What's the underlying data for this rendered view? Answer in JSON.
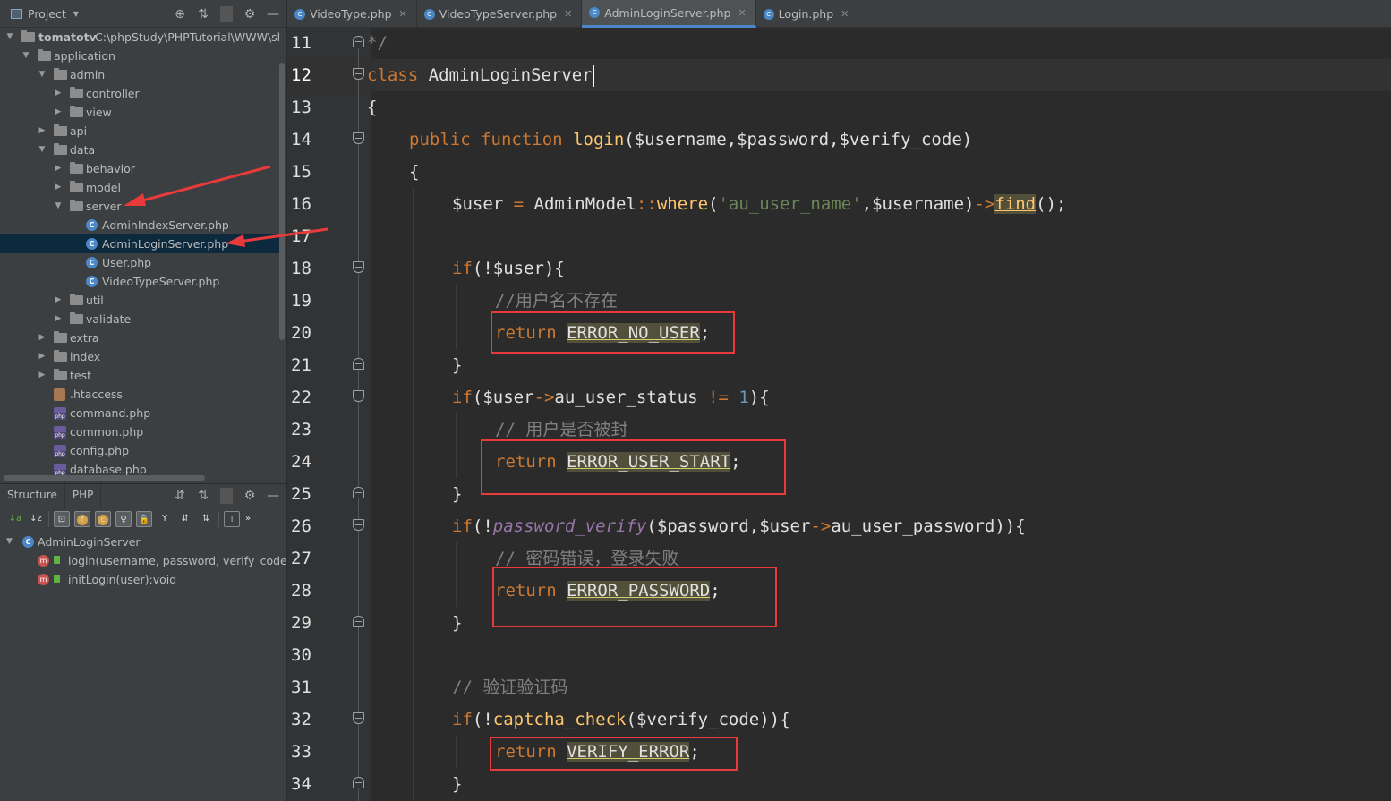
{
  "project": {
    "title": "Project",
    "root_name": "tomatotv",
    "root_path": "C:\\phpStudy\\PHPTutorial\\WWW\\ship",
    "tree": [
      {
        "label": "application",
        "arrow": "▼",
        "type": "folder"
      },
      {
        "label": "admin",
        "arrow": "▼",
        "type": "folder"
      },
      {
        "label": "controller",
        "arrow": "▶",
        "type": "folder"
      },
      {
        "label": "view",
        "arrow": "▶",
        "type": "folder"
      },
      {
        "label": "api",
        "arrow": "▶",
        "type": "folder"
      },
      {
        "label": "data",
        "arrow": "▼",
        "type": "folder"
      },
      {
        "label": "behavior",
        "arrow": "▶",
        "type": "folder"
      },
      {
        "label": "model",
        "arrow": "▶",
        "type": "folder"
      },
      {
        "label": "server",
        "arrow": "▼",
        "type": "folder"
      },
      {
        "label": "AdminIndexServer.php",
        "arrow": "",
        "type": "class"
      },
      {
        "label": "AdminLoginServer.php",
        "arrow": "",
        "type": "class"
      },
      {
        "label": "User.php",
        "arrow": "",
        "type": "class"
      },
      {
        "label": "VideoTypeServer.php",
        "arrow": "",
        "type": "class"
      },
      {
        "label": "util",
        "arrow": "▶",
        "type": "folder"
      },
      {
        "label": "validate",
        "arrow": "▶",
        "type": "folder"
      },
      {
        "label": "extra",
        "arrow": "▶",
        "type": "folder"
      },
      {
        "label": "index",
        "arrow": "▶",
        "type": "folder"
      },
      {
        "label": "test",
        "arrow": "▶",
        "type": "folder"
      },
      {
        "label": ".htaccess",
        "arrow": "",
        "type": "htaccess"
      },
      {
        "label": "command.php",
        "arrow": "",
        "type": "php"
      },
      {
        "label": "common.php",
        "arrow": "",
        "type": "php"
      },
      {
        "label": "config.php",
        "arrow": "",
        "type": "php"
      },
      {
        "label": "database.php",
        "arrow": "",
        "type": "php"
      }
    ]
  },
  "structure": {
    "tabs": [
      "Structure",
      "PHP"
    ],
    "class_name": "AdminLoginServer",
    "members": [
      "login(username, password, verify_code):",
      "initLogin(user):void"
    ]
  },
  "editor": {
    "tabs": [
      {
        "label": "VideoType.php",
        "active": false
      },
      {
        "label": "VideoTypeServer.php",
        "active": false
      },
      {
        "label": "AdminLoginServer.php",
        "active": true
      },
      {
        "label": "Login.php",
        "active": false
      }
    ],
    "line_numbers": [
      "11",
      "12",
      "13",
      "14",
      "15",
      "16",
      "17",
      "18",
      "19",
      "20",
      "21",
      "22",
      "23",
      "24",
      "25",
      "26",
      "27",
      "28",
      "29",
      "30",
      "31",
      "32",
      "33",
      "34"
    ],
    "code": {
      "l11": "*/",
      "l12_kw": "class",
      "l12_name": "AdminLoginServer",
      "l13": "{",
      "l14_kw1": "public",
      "l14_kw2": "function",
      "l14_fn": "login",
      "l14_args": "($username,$password,$verify_code)",
      "l15": "{",
      "l16_var": "$user",
      "l16_eq": " = ",
      "l16_cls": "AdminModel",
      "l16_sep": "::",
      "l16_m": "where",
      "l16_p1": "(",
      "l16_str": "'au_user_name'",
      "l16_p2": ",$username)",
      "l16_arrow": "->",
      "l16_find": "find",
      "l16_end": "();",
      "l18_if": "if",
      "l18_rest": "(!$user){",
      "l19": "//用户名不存在",
      "l20_kw": "return",
      "l20_const": "ERROR_NO_USER",
      "l21": "}",
      "l22_if": "if",
      "l22_a": "($user",
      "l22_arrow": "->",
      "l22_b": "au_user_status",
      "l22_ne": " != ",
      "l22_num": "1",
      "l22_c": "){",
      "l23": "// 用户是否被封",
      "l24_kw": "return",
      "l24_const": "ERROR_USER_START",
      "l25": "}",
      "l26_if": "if",
      "l26_not": "(!",
      "l26_fn": "password_verify",
      "l26_a": "($password,$user",
      "l26_arrow": "->",
      "l26_b": "au_user_password)){",
      "l27": "// 密码错误，登录失败",
      "l28_kw": "return",
      "l28_const": "ERROR_PASSWORD",
      "l29": "}",
      "l31": "// 验证验证码",
      "l32_if": "if",
      "l32_not": "(!",
      "l32_fn": "captcha_check",
      "l32_a": "($verify_code)){",
      "l33_kw": "return",
      "l33_const": "VERIFY_ERROR",
      "l34": "}",
      "semi": ";"
    }
  },
  "colors": {
    "annotation_red": "#e83a3a",
    "keyword": "#cc7832",
    "function": "#ffc66d",
    "string": "#6a8759",
    "comment": "#808080"
  }
}
